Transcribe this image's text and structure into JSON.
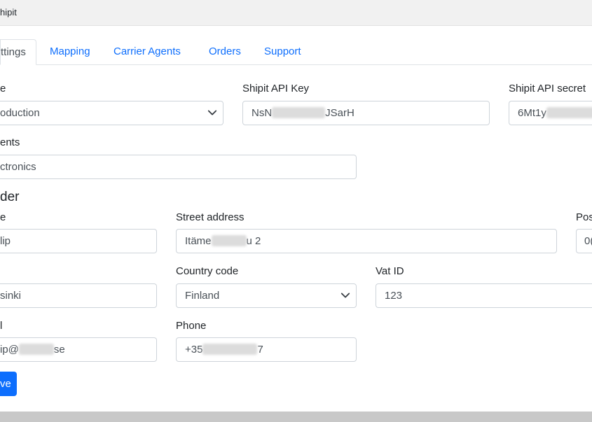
{
  "window": {
    "title": "hipit"
  },
  "tabs": [
    {
      "label": "ttings",
      "active": true
    },
    {
      "label": "Mapping",
      "active": false
    },
    {
      "label": "Carrier Agents",
      "active": false
    },
    {
      "label": "Orders",
      "active": false
    },
    {
      "label": "Support",
      "active": false
    }
  ],
  "api": {
    "mode_label": "e",
    "mode_value": "oduction",
    "key_label": "Shipit API Key",
    "key_prefix": "NsN",
    "key_suffix": "JSarH",
    "secret_label": "Shipit API secret",
    "secret_prefix": "6Mt1y"
  },
  "contents": {
    "label": "ents",
    "value": "ctronics"
  },
  "sender": {
    "heading": "der",
    "name_label": "e",
    "name_value": "lip",
    "street_label": "Street address",
    "street_prefix": "Itäme",
    "street_suffix": "u 2",
    "postal_label": "Pos",
    "postal_value": "0(",
    "city_value": "sinki",
    "country_label": "Country code",
    "country_value": "Finland",
    "vat_label": "Vat ID",
    "vat_value": "123",
    "email_label": "l",
    "email_prefix": "ip@",
    "email_suffix": "se",
    "phone_label": "Phone",
    "phone_prefix": "+35",
    "phone_suffix": "7"
  },
  "actions": {
    "save_label": "ve"
  },
  "colors": {
    "primary": "#0d6efd",
    "border": "#ced4da",
    "text": "#212529"
  }
}
